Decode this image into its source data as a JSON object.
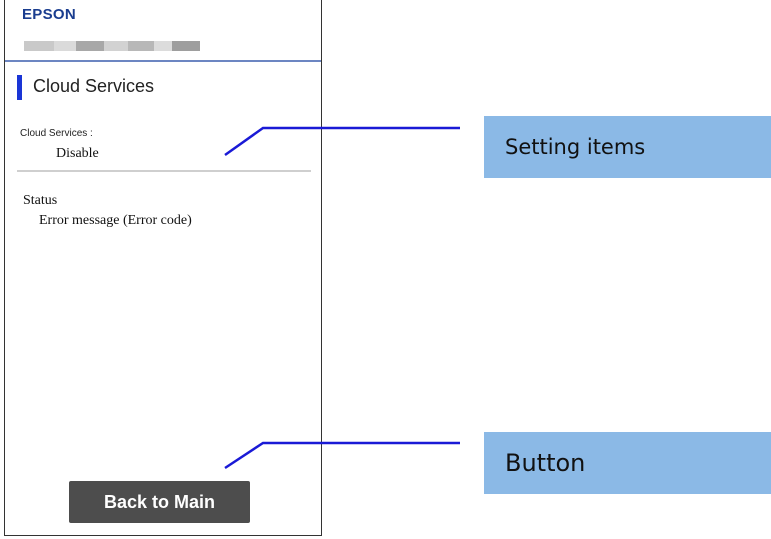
{
  "screen": {
    "brand": "EPSON",
    "page_title": "Cloud Services",
    "setting_label": "Cloud Services :",
    "setting_value": "Disable",
    "status_label": "Status",
    "status_message": "Error message (Error code)",
    "back_button": "Back to Main"
  },
  "callouts": {
    "setting_items": "Setting items",
    "button": "Button"
  },
  "colors": {
    "brand": "#1a3d8f",
    "accent": "#1a35d6",
    "button": "#4d4d4d",
    "callout_bg": "#8bb9e6",
    "leader_line": "#1a1ad6"
  }
}
